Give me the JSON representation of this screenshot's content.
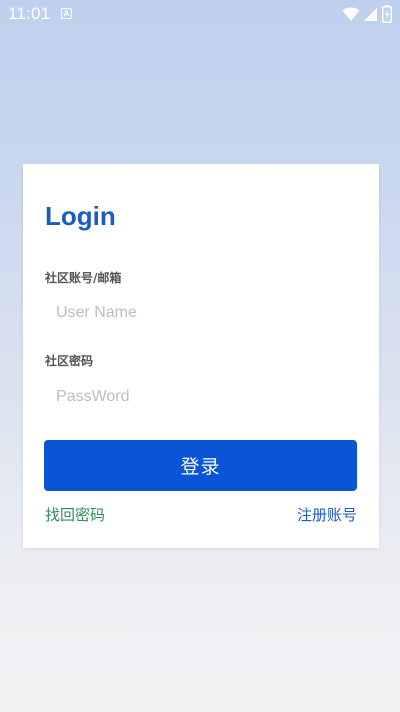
{
  "status_bar": {
    "time": "11:01",
    "notification_icon_letter": "A",
    "icons": [
      "wifi-icon",
      "signal-icon",
      "battery-charging-icon"
    ]
  },
  "login": {
    "title": "Login",
    "account_label": "社区账号/邮箱",
    "account_placeholder": "User Name",
    "account_value": "",
    "password_label": "社区密码",
    "password_placeholder": "PassWord",
    "password_value": "",
    "submit_label": "登录",
    "forgot_password_link": "找回密码",
    "register_link": "注册账号"
  },
  "colors": {
    "accent": "#0a55d6",
    "title": "#1a5bc4",
    "forgot_link": "#2f8a5a",
    "register_link": "#1a5bc4"
  }
}
